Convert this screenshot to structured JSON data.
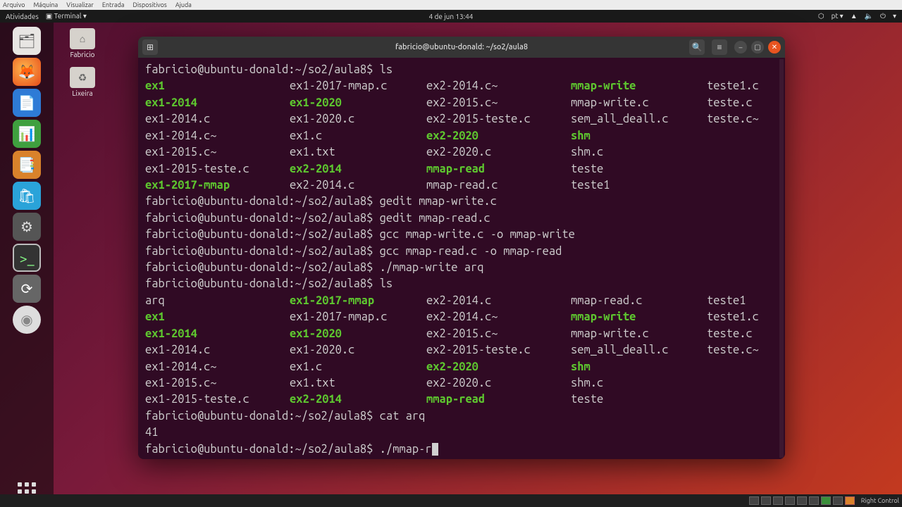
{
  "vm_menu": [
    "Arquivo",
    "Máquina",
    "Visualizar",
    "Entrada",
    "Dispositivos",
    "Ajuda"
  ],
  "gnome": {
    "activities": "Atividades",
    "app": "Terminal ▾",
    "clock": "4 de jun  13:44",
    "lang": "pt ▾"
  },
  "desktop": {
    "home": "Fabricio",
    "trash": "Lixeira"
  },
  "window": {
    "title": "fabricio@ubuntu-donald: ~/so2/aula8"
  },
  "prompt": "fabricio@ubuntu-donald:~/so2/aula8$",
  "lines": [
    {
      "t": "cmd",
      "cmd": "ls"
    },
    {
      "t": "ls",
      "cells": [
        [
          "ex1",
          "g"
        ],
        [
          "ex1-2017-mmap.c",
          ""
        ],
        [
          "ex2-2014.c~",
          ""
        ],
        [
          "mmap-write",
          "g"
        ],
        [
          "teste1.c",
          ""
        ]
      ]
    },
    {
      "t": "ls",
      "cells": [
        [
          "ex1-2014",
          "g"
        ],
        [
          "ex1-2020",
          "g"
        ],
        [
          "ex2-2015.c~",
          ""
        ],
        [
          "mmap-write.c",
          ""
        ],
        [
          "teste.c",
          ""
        ]
      ]
    },
    {
      "t": "ls",
      "cells": [
        [
          "ex1-2014.c",
          ""
        ],
        [
          "ex1-2020.c",
          ""
        ],
        [
          "ex2-2015-teste.c",
          ""
        ],
        [
          "sem_all_deall.c",
          ""
        ],
        [
          "teste.c~",
          ""
        ]
      ]
    },
    {
      "t": "ls",
      "cells": [
        [
          "ex1-2014.c~",
          ""
        ],
        [
          "ex1.c",
          ""
        ],
        [
          "ex2-2020",
          "g"
        ],
        [
          "shm",
          "g"
        ],
        [
          "",
          ""
        ]
      ]
    },
    {
      "t": "ls",
      "cells": [
        [
          "ex1-2015.c~",
          ""
        ],
        [
          "ex1.txt",
          ""
        ],
        [
          "ex2-2020.c",
          ""
        ],
        [
          "shm.c",
          ""
        ],
        [
          "",
          ""
        ]
      ]
    },
    {
      "t": "ls",
      "cells": [
        [
          "ex1-2015-teste.c",
          ""
        ],
        [
          "ex2-2014",
          "g"
        ],
        [
          "mmap-read",
          "g"
        ],
        [
          "teste",
          ""
        ],
        [
          "",
          ""
        ]
      ]
    },
    {
      "t": "ls",
      "cells": [
        [
          "ex1-2017-mmap",
          "g"
        ],
        [
          "ex2-2014.c",
          ""
        ],
        [
          "mmap-read.c",
          ""
        ],
        [
          "teste1",
          ""
        ],
        [
          "",
          ""
        ]
      ]
    },
    {
      "t": "cmd",
      "cmd": "gedit mmap-write.c"
    },
    {
      "t": "cmd",
      "cmd": "gedit mmap-read.c"
    },
    {
      "t": "cmd",
      "cmd": "gcc mmap-write.c -o mmap-write"
    },
    {
      "t": "cmd",
      "cmd": "gcc mmap-read.c -o mmap-read"
    },
    {
      "t": "cmd",
      "cmd": "./mmap-write arq"
    },
    {
      "t": "cmd",
      "cmd": "ls"
    },
    {
      "t": "ls",
      "cells": [
        [
          "arq",
          ""
        ],
        [
          "ex1-2017-mmap",
          "g"
        ],
        [
          "ex2-2014.c",
          ""
        ],
        [
          "mmap-read.c",
          ""
        ],
        [
          "teste1",
          ""
        ]
      ]
    },
    {
      "t": "ls",
      "cells": [
        [
          "ex1",
          "g"
        ],
        [
          "ex1-2017-mmap.c",
          ""
        ],
        [
          "ex2-2014.c~",
          ""
        ],
        [
          "mmap-write",
          "g"
        ],
        [
          "teste1.c",
          ""
        ]
      ]
    },
    {
      "t": "ls",
      "cells": [
        [
          "ex1-2014",
          "g"
        ],
        [
          "ex1-2020",
          "g"
        ],
        [
          "ex2-2015.c~",
          ""
        ],
        [
          "mmap-write.c",
          ""
        ],
        [
          "teste.c",
          ""
        ]
      ]
    },
    {
      "t": "ls",
      "cells": [
        [
          "ex1-2014.c",
          ""
        ],
        [
          "ex1-2020.c",
          ""
        ],
        [
          "ex2-2015-teste.c",
          ""
        ],
        [
          "sem_all_deall.c",
          ""
        ],
        [
          "teste.c~",
          ""
        ]
      ]
    },
    {
      "t": "ls",
      "cells": [
        [
          "ex1-2014.c~",
          ""
        ],
        [
          "ex1.c",
          ""
        ],
        [
          "ex2-2020",
          "g"
        ],
        [
          "shm",
          "g"
        ],
        [
          "",
          ""
        ]
      ]
    },
    {
      "t": "ls",
      "cells": [
        [
          "ex1-2015.c~",
          ""
        ],
        [
          "ex1.txt",
          ""
        ],
        [
          "ex2-2020.c",
          ""
        ],
        [
          "shm.c",
          ""
        ],
        [
          "",
          ""
        ]
      ]
    },
    {
      "t": "ls",
      "cells": [
        [
          "ex1-2015-teste.c",
          ""
        ],
        [
          "ex2-2014",
          "g"
        ],
        [
          "mmap-read",
          "g"
        ],
        [
          "teste",
          ""
        ],
        [
          "",
          ""
        ]
      ]
    },
    {
      "t": "cmd",
      "cmd": "cat arq"
    },
    {
      "t": "out",
      "text": "41"
    },
    {
      "t": "cursor",
      "cmd": "./mmap-r"
    }
  ],
  "bottom_tray_label": "Right Control"
}
